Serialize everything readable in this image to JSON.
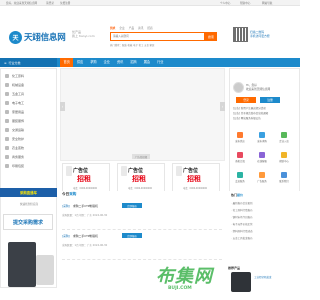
{
  "topbar": {
    "links": [
      "您好，欢迎来到天翊信息网",
      "请登录",
      "免费注册",
      "个人中心",
      "帮助中心",
      "网站导航"
    ]
  },
  "logo": {
    "mark": "天",
    "name": "天翊信息网"
  },
  "slogan": {
    "line1": "优产品",
    "line2": "我上 tianyi.com"
  },
  "search": {
    "tabs": [
      "供求",
      "企业",
      "产品",
      "资讯",
      "招商"
    ],
    "placeholder": "请输入关键词",
    "button": "搜索",
    "hot": "热门搜索：服装 机械 电子 化工 五金 家居"
  },
  "qr": {
    "text1": "扫描二维码",
    "text2": "手机访问更方便"
  },
  "nav": {
    "category": "行业分类",
    "items": [
      "首页",
      "供应",
      "求购",
      "企业",
      "资讯",
      "招商",
      "展会",
      "行业"
    ]
  },
  "sidebar": {
    "items": [
      "化工原料",
      "机械设备",
      "五金工具",
      "电子电工",
      "家居用品",
      "服装服饰",
      "交通运输",
      "安全防护",
      "农业畜牧",
      "商务服务",
      "印刷包装"
    ]
  },
  "banner": {
    "label": "广告位招租"
  },
  "ads": [
    {
      "title": "广告位",
      "big": "招租",
      "phone": "电话：0000-00000000"
    },
    {
      "title": "广告位",
      "big": "招租",
      "phone": "电话：0000-00000000"
    },
    {
      "title": "广告位",
      "big": "招租",
      "phone": "电话：0000-00000000"
    },
    {
      "title": "广告位",
      "big": "招租",
      "phone": "电话：0000-00000000"
    },
    {
      "title": "广告位",
      "big": "招租",
      "phone": "电话：0000-00000000"
    },
    {
      "title": "广告位",
      "big": "招租",
      "phone": "电话：0000-00000000"
    }
  ],
  "user": {
    "welcome": "Hi，您好",
    "desc": "欢迎来到天翊信息网",
    "login": "登录",
    "register": "注册"
  },
  "notices": [
    "[公告] 新用户注册送积分活动",
    "[公告] 关于规范发布信息的通知",
    "[公告] 网站服务升级公告"
  ],
  "quick": [
    "发布供应",
    "发布求购",
    "企业入驻",
    "商机订阅",
    "在线客服",
    "帮助中心",
    "会员服务",
    "广告服务",
    "联系我们"
  ],
  "kd": {
    "head": "采购直通车",
    "btn": "提交采购需求",
    "sub": "快速找到供应商"
  },
  "today": {
    "title_a": "今日",
    "title_b": "采购",
    "rows": [
      {
        "tag": "[采购]",
        "title": "求购二手CTP制版机",
        "btn": "立即报价",
        "meta": "采购数量：1台  地区：广东  2024-06-30"
      },
      {
        "tag": "[采购]",
        "title": "求购二手CTP制版机",
        "btn": "立即报价",
        "meta": "采购数量：1台  地区：广东  2024-06-30"
      }
    ]
  },
  "quote": {
    "title_a": "热门",
    "title_b": "报价",
    "rows": [
      "· 最新报价信息更新",
      "· 化工原料行情报价",
      "· 钢材市场今日报价",
      "· 电子元件价格走势",
      "· 塑料原料行情动态",
      "· 五金工具批发报价"
    ]
  },
  "promo": {
    "head": "推荐产品",
    "text": "工业打印机批发"
  },
  "watermark": {
    "main": "布集网",
    "sub": "BUJI.COM"
  }
}
